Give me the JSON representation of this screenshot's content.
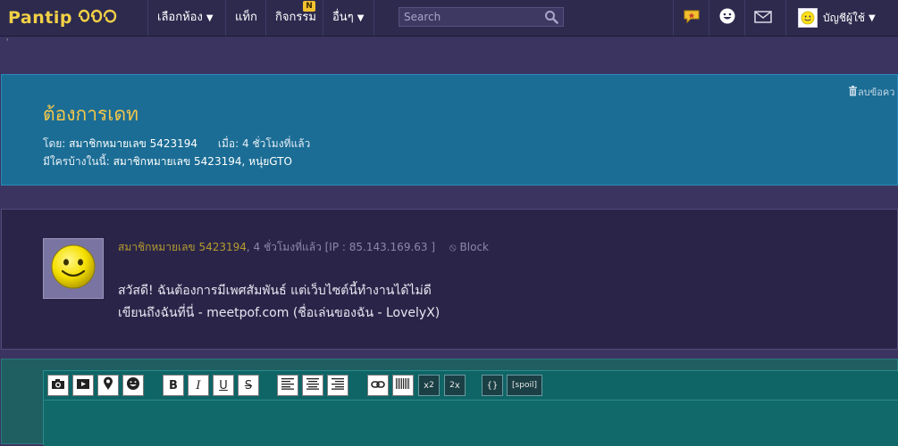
{
  "nav": {
    "logo": "Pantip",
    "rooms": "เลือกห้อง",
    "tags": "แท็ก",
    "activities": "กิจกรรม",
    "activities_badge": "N",
    "others": "อื่นๆ",
    "search_placeholder": "Search",
    "account": "บัญชีผู้ใช้"
  },
  "topic": {
    "title": "ต้องการเดท",
    "by_label": "โดย:",
    "author": "สมาชิกหมายเลข 5423194",
    "when_label": "เมื่อ:",
    "when": "4 ชั่วโมงที่แล้ว",
    "viewers_label": "มีใครบ้างในนี้:",
    "viewers": "สมาชิกหมายเลข 5423194, หนุ่ยGTO",
    "delete": "ลบข้อคว"
  },
  "comment": {
    "author": "สมาชิกหมายเลข 5423194",
    "time_ip": ", 4 ชั่วโมงที่แล้ว [IP : 85.143.169.63 ]",
    "block": "Block",
    "line1": "สวัสดี! ฉันต้องการมีเพศสัมพันธ์ แต่เว็บไซต์นี้ทำงานได้ไม่ดี",
    "line2": "เขียนถึงฉันที่นี่ - meetpof.com (ชื่อเล่นของฉัน - LovelyX)"
  },
  "toolbar": {
    "bold": "B",
    "italic": "I",
    "underline": "U",
    "strike": "S",
    "sup": "x",
    "sup_exp": "2",
    "sub": "x",
    "sub_exp": "2",
    "code": "{}",
    "spoil": "[spoil]"
  },
  "icons": [
    "logo-mark-icon",
    "chevron-down-icon",
    "search-icon",
    "pantip-point-icon",
    "smiley-icon",
    "mail-icon",
    "user-avatar-icon",
    "trash-icon",
    "block-icon",
    "camera-icon",
    "youtube-icon",
    "map-pin-icon",
    "emoji-icon",
    "align-left-icon",
    "align-center-icon",
    "align-right-icon",
    "link-icon",
    "barcode-icon"
  ],
  "colors": {
    "accent": "#f5c74a",
    "topic_bg": "#1b6d95",
    "comment_bg": "#2a2548",
    "page_bg": "#3b3461",
    "nav_bg": "#2d2a4e",
    "reply_bg": "#1f5e61"
  }
}
